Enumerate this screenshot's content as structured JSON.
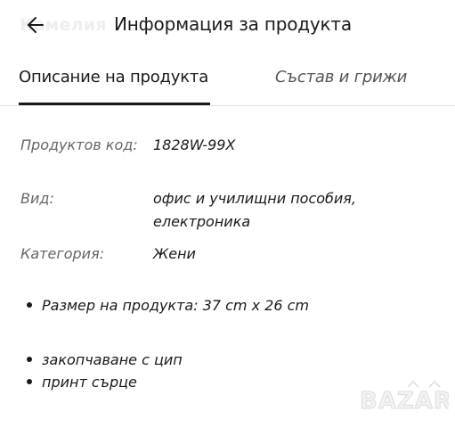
{
  "header": {
    "ghost_title": "Камелия",
    "title": "Информация за продукта",
    "back_icon": "arrow-left-icon"
  },
  "tabs": [
    {
      "label": "Описание на продукта",
      "active": true
    },
    {
      "label": "Състав и грижи",
      "active": false
    }
  ],
  "specs": {
    "code_label": "Продуктов код:",
    "code_value": "1828W-99X",
    "type_label": "Вид:",
    "type_value_line1": "офис и училищни пособия,",
    "type_value_line2": "електроника",
    "category_label": "Категория:",
    "category_value": "Жени"
  },
  "bullets": [
    "Размер на продукта: 37 cm x 26 cm",
    "закопчаване с цип",
    "принт сърце"
  ],
  "watermark": {
    "text": "BAZAR"
  },
  "colors": {
    "text": "#1a1a1a",
    "muted": "#666666",
    "divider": "#e3e3e3"
  }
}
